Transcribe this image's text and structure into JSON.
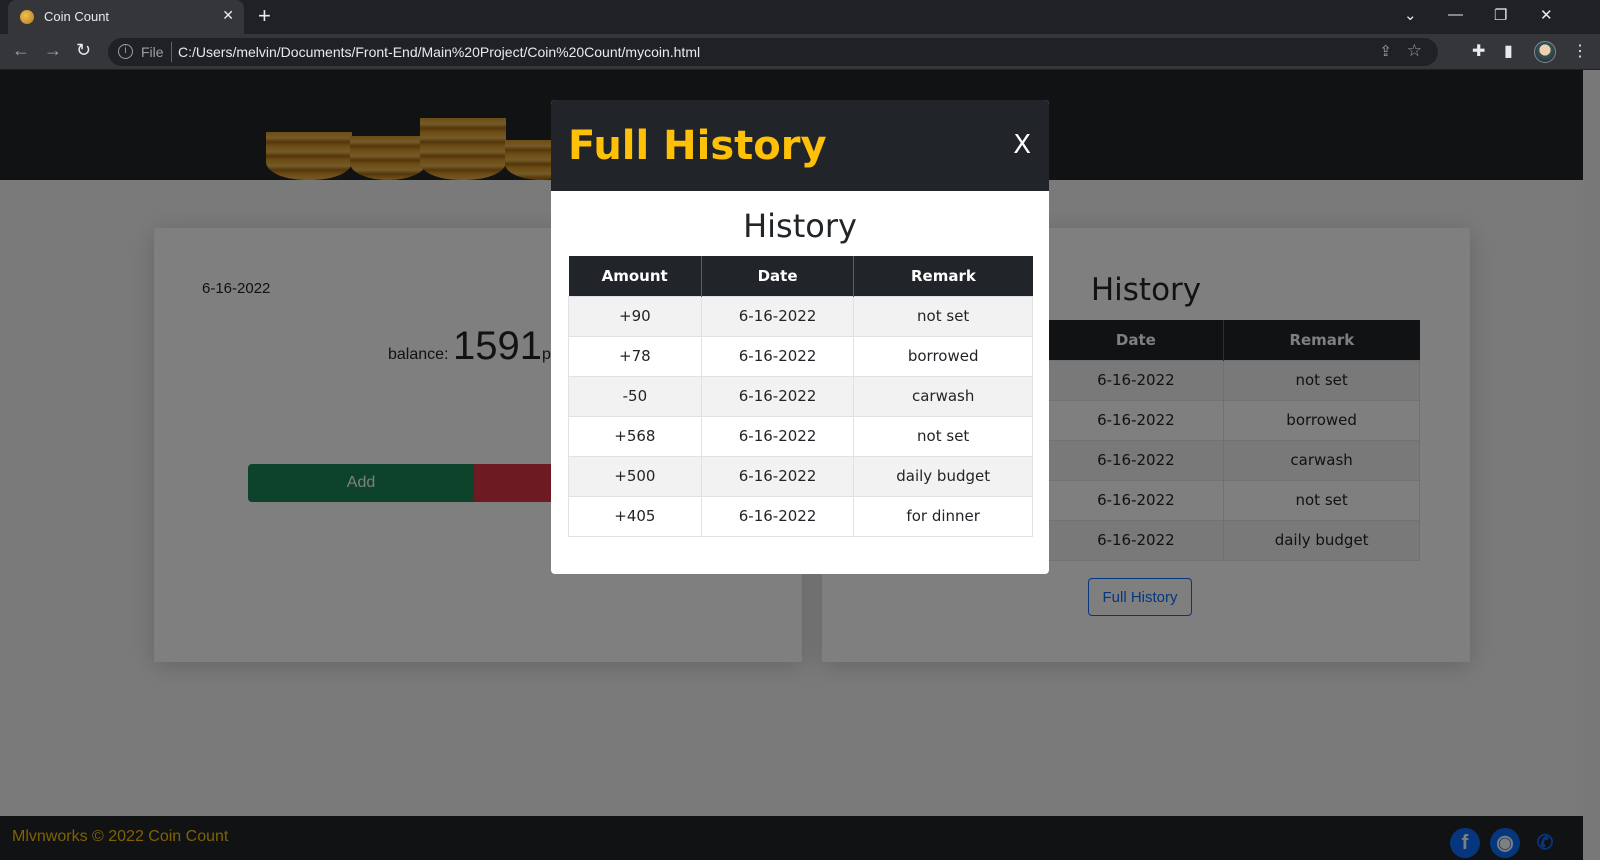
{
  "browser": {
    "tab_title": "Coin Count",
    "url_scheme": "File",
    "url": "C:/Users/melvin/Documents/Front-End/Main%20Project/Coin%20Count/mycoin.html"
  },
  "balance_card": {
    "date": "6-16-2022",
    "balance_label": "balance:",
    "balance_value": "1591",
    "currency": "ph",
    "add_label": "Add"
  },
  "history_card": {
    "title": "History",
    "headers": [
      "Date",
      "Remark"
    ],
    "rows": [
      [
        "6-16-2022",
        "not set"
      ],
      [
        "6-16-2022",
        "borrowed"
      ],
      [
        "6-16-2022",
        "carwash"
      ],
      [
        "6-16-2022",
        "not set"
      ],
      [
        "6-16-2022",
        "daily budget"
      ]
    ],
    "full_history_label": "Full History"
  },
  "footer": {
    "text": "Mlvnworks © 2022 Coin Count"
  },
  "modal": {
    "title": "Full History",
    "close_label": "X",
    "heading": "History",
    "headers": [
      "Amount",
      "Date",
      "Remark"
    ],
    "rows": [
      [
        "+90",
        "6-16-2022",
        "not set"
      ],
      [
        "+78",
        "6-16-2022",
        "borrowed"
      ],
      [
        "-50",
        "6-16-2022",
        "carwash"
      ],
      [
        "+568",
        "6-16-2022",
        "not set"
      ],
      [
        "+500",
        "6-16-2022",
        "daily budget"
      ],
      [
        "+405",
        "6-16-2022",
        "for dinner"
      ]
    ]
  },
  "colors": {
    "dark": "#212529",
    "accent": "#ffc107",
    "success": "#198754",
    "danger": "#dc3545",
    "primary": "#0d6efd"
  }
}
